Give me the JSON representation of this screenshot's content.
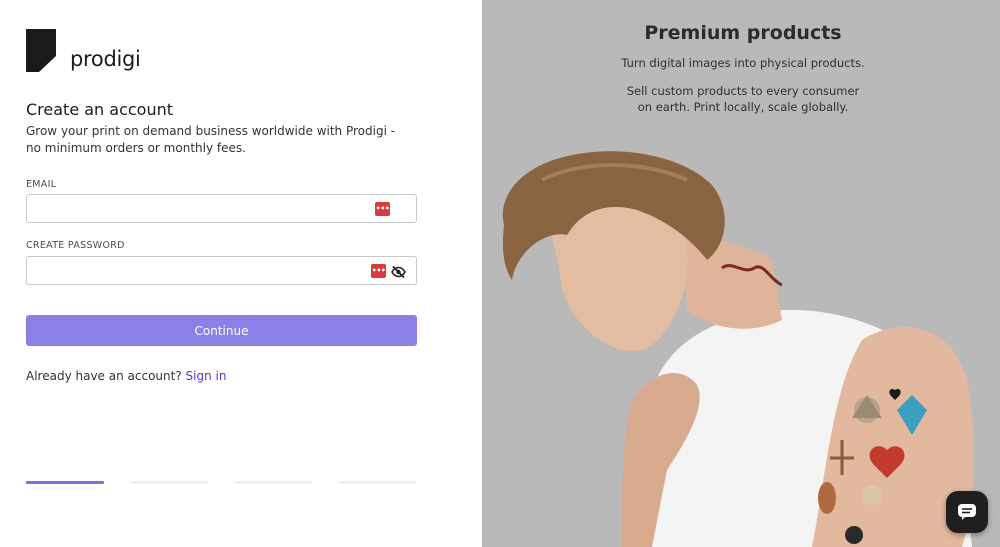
{
  "brand": {
    "name": "prodigi"
  },
  "form": {
    "title": "Create an account",
    "subtitle": "Grow your print on demand business worldwide with Prodigi - no minimum orders or monthly fees.",
    "email_label": "EMAIL",
    "email_value": "",
    "password_label": "CREATE PASSWORD",
    "password_value": "",
    "continue_label": "Continue",
    "signin_prompt": "Already have an account?",
    "signin_link": "Sign in"
  },
  "progress": {
    "steps": 4,
    "current": 1
  },
  "promo": {
    "title": "Premium products",
    "line1": "Turn digital images into physical products.",
    "line2": "Sell custom products to every consumer on earth. Print locally, scale globally."
  },
  "colors": {
    "accent": "#8b80e8",
    "link": "#4a3fd1",
    "right_panel_bg": "#b9b9b9",
    "password_manager": "#d93a3a"
  },
  "icons": {
    "logo": "prodigi-logo-icon",
    "password_manager": "password-manager-icon",
    "visibility": "eye-slash-icon",
    "chat": "chat-bubble-icon"
  }
}
